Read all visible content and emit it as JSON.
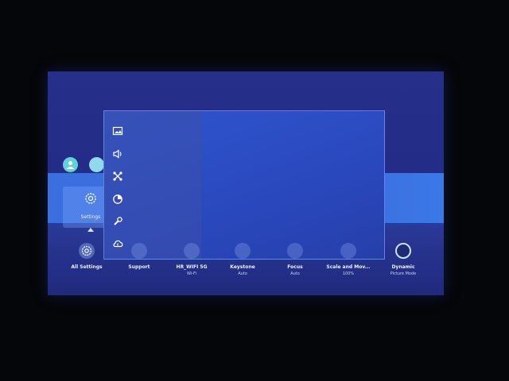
{
  "menu_tile": {
    "label": "Settings",
    "icon": "gear-icon"
  },
  "panel_icons": [
    "picture-icon",
    "sound-icon",
    "connection-icon",
    "general-icon",
    "support-icon",
    "network-icon"
  ],
  "quick_bar": [
    {
      "title": "All Settings",
      "sub": "",
      "icon": "gear-icon"
    },
    {
      "title": "Support",
      "sub": ""
    },
    {
      "title": "HR_WIFI 5G",
      "sub": "Wi-Fi"
    },
    {
      "title": "Keystone",
      "sub": "Auto"
    },
    {
      "title": "Focus",
      "sub": "Auto"
    },
    {
      "title": "Scale and Mov...",
      "sub": "100%"
    },
    {
      "title": "Dynamic",
      "sub": "Picture Mode"
    }
  ],
  "colors": {
    "screen": "#26308a",
    "band": "#3b6fe0",
    "panel": "#2f55cf"
  }
}
